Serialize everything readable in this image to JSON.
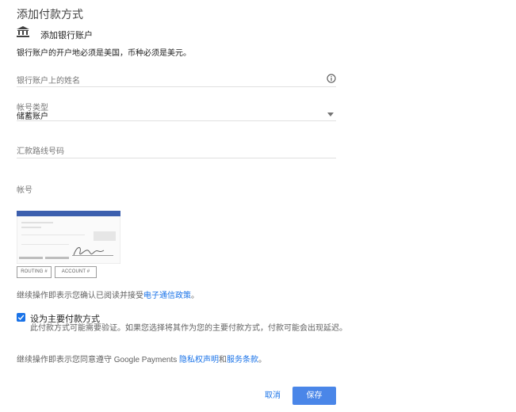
{
  "header": {
    "title": "添加付款方式",
    "bank_label": "添加银行账户",
    "notice": "银行账户的开户地必须是美国，币种必须是美元。"
  },
  "form": {
    "name_field": {
      "placeholder": "银行账户上的姓名"
    },
    "account_type": {
      "label": "帐号类型",
      "value": "储蓄账户"
    },
    "routing_field": {
      "placeholder": "汇款路线号码"
    },
    "account_field": {
      "placeholder": "帐号"
    }
  },
  "check_image": {
    "routing_label": "ROUTING #",
    "account_label": "ACCOUNT #"
  },
  "consent": {
    "prefix": "继续操作即表示您确认已阅读并接受",
    "link": "电子通信政策",
    "suffix": "。"
  },
  "primary": {
    "checked": true,
    "title": "设为主要付款方式",
    "description": "此付款方式可能需要验证。如果您选择将其作为您的主要付款方式，付款可能会出现延迟。"
  },
  "terms": {
    "prefix": "继续操作即表示您同意遵守 Google Payments ",
    "privacy_link": "隐私权声明",
    "and": "和",
    "terms_link": "服务条款",
    "suffix": "。"
  },
  "actions": {
    "cancel_label": "取消",
    "save_label": "保存"
  },
  "colors": {
    "accent": "#1a73e8",
    "save_button": "#4a86e8",
    "check_bar": "#3c5fae"
  },
  "icons": {
    "bank": "bank-icon",
    "info": "info-icon",
    "dropdown": "chevron-down-icon",
    "checkbox": "checkbox-checked-icon"
  }
}
